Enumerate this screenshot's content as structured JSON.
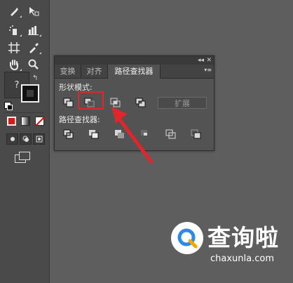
{
  "toolbar": {
    "tools": [
      {
        "name": "pen-tool",
        "glyph": "✒"
      },
      {
        "name": "direct-selection-tool",
        "glyph": "⌕"
      },
      {
        "name": "symbol-sprayer-tool",
        "glyph": "◎"
      },
      {
        "name": "column-graph-tool",
        "glyph": "▥"
      },
      {
        "name": "artboard-tool",
        "glyph": "⌗"
      },
      {
        "name": "slice-tool",
        "glyph": "✎"
      },
      {
        "name": "hand-tool",
        "glyph": "✋"
      },
      {
        "name": "zoom-tool",
        "glyph": "⚲"
      }
    ],
    "tooltip_text": "?"
  },
  "panel": {
    "tabs": [
      "变换",
      "对齐",
      "路径查找器"
    ],
    "active_tab": "路径查找器",
    "shape_modes_label": "形状模式:",
    "expand_label": "扩展",
    "pathfinders_label": "路径查找器:"
  },
  "colors": {
    "highlight": "#e0262b",
    "fill_mode": "#d21b1b"
  },
  "watermark": {
    "text": "查询啦",
    "url": "chaxunla.com"
  }
}
